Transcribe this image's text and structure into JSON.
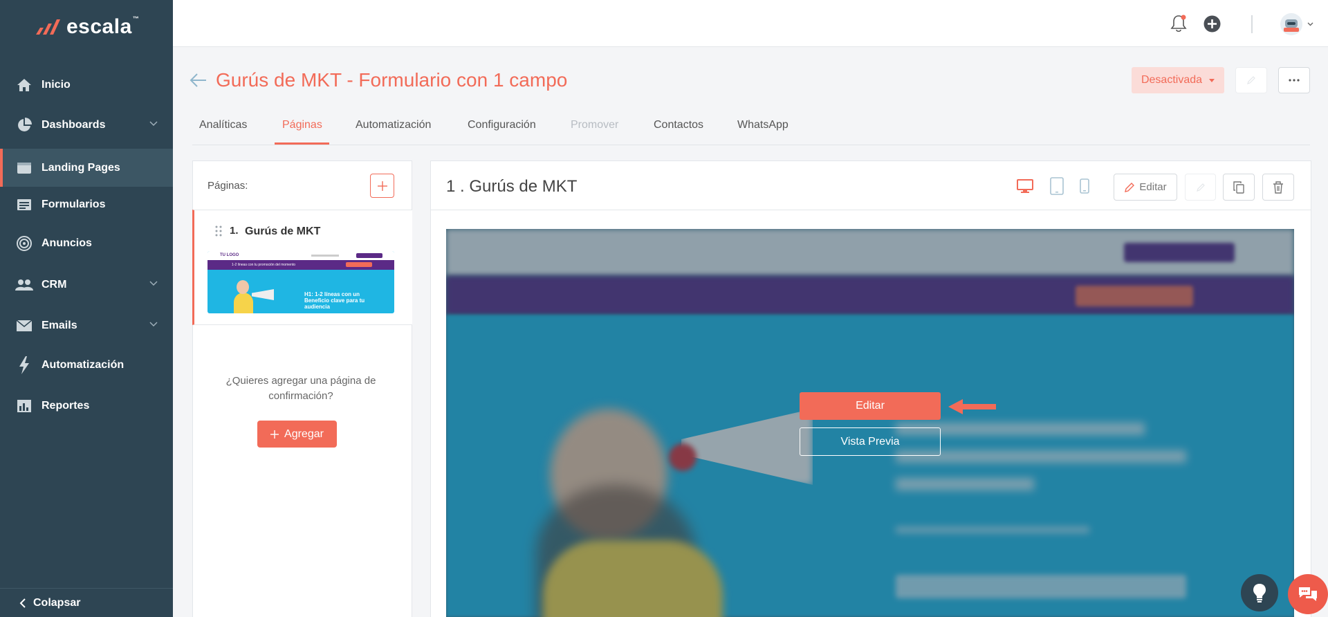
{
  "brand": {
    "name": "escala",
    "tm": "™"
  },
  "sidebar": {
    "items": [
      {
        "label": "Inicio",
        "icon": "home-icon"
      },
      {
        "label": "Dashboards",
        "icon": "pie-chart-icon"
      },
      {
        "label": "Landing Pages",
        "icon": "browser-window-icon"
      },
      {
        "label": "Formularios",
        "icon": "form-icon"
      },
      {
        "label": "Anuncios",
        "icon": "target-icon"
      },
      {
        "label": "CRM",
        "icon": "users-icon"
      },
      {
        "label": "Emails",
        "icon": "envelope-icon"
      },
      {
        "label": "Automatización",
        "icon": "lightning-icon"
      },
      {
        "label": "Reportes",
        "icon": "report-icon"
      }
    ],
    "collapse_label": "Colapsar"
  },
  "header": {
    "title": "Gurús de MKT - Formulario con 1 campo",
    "status_label": "Desactivada"
  },
  "tabs": [
    "Analíticas",
    "Páginas",
    "Automatización",
    "Configuración",
    "Promover",
    "Contactos",
    "WhatsApp"
  ],
  "pages_panel": {
    "label": "Páginas:",
    "items": [
      {
        "num": "1.",
        "name": "Gurús de MKT"
      }
    ],
    "confirm_text": "¿Quieres agregar una página de confirmación?",
    "add_label": "Agregar"
  },
  "thumbnail": {
    "logo": "TU LOGO",
    "banner": "1-2 líneas con tu promoción del momento",
    "headline": "H1: 1-2 líneas con un Beneficio clave para tu audiencia"
  },
  "editor": {
    "title": "1 . Gurús de MKT",
    "edit_label": "Editar",
    "overlay_edit": "Editar",
    "overlay_preview": "Vista Previa"
  },
  "colors": {
    "accent": "#f26b58",
    "sidebar": "#2e4553"
  }
}
